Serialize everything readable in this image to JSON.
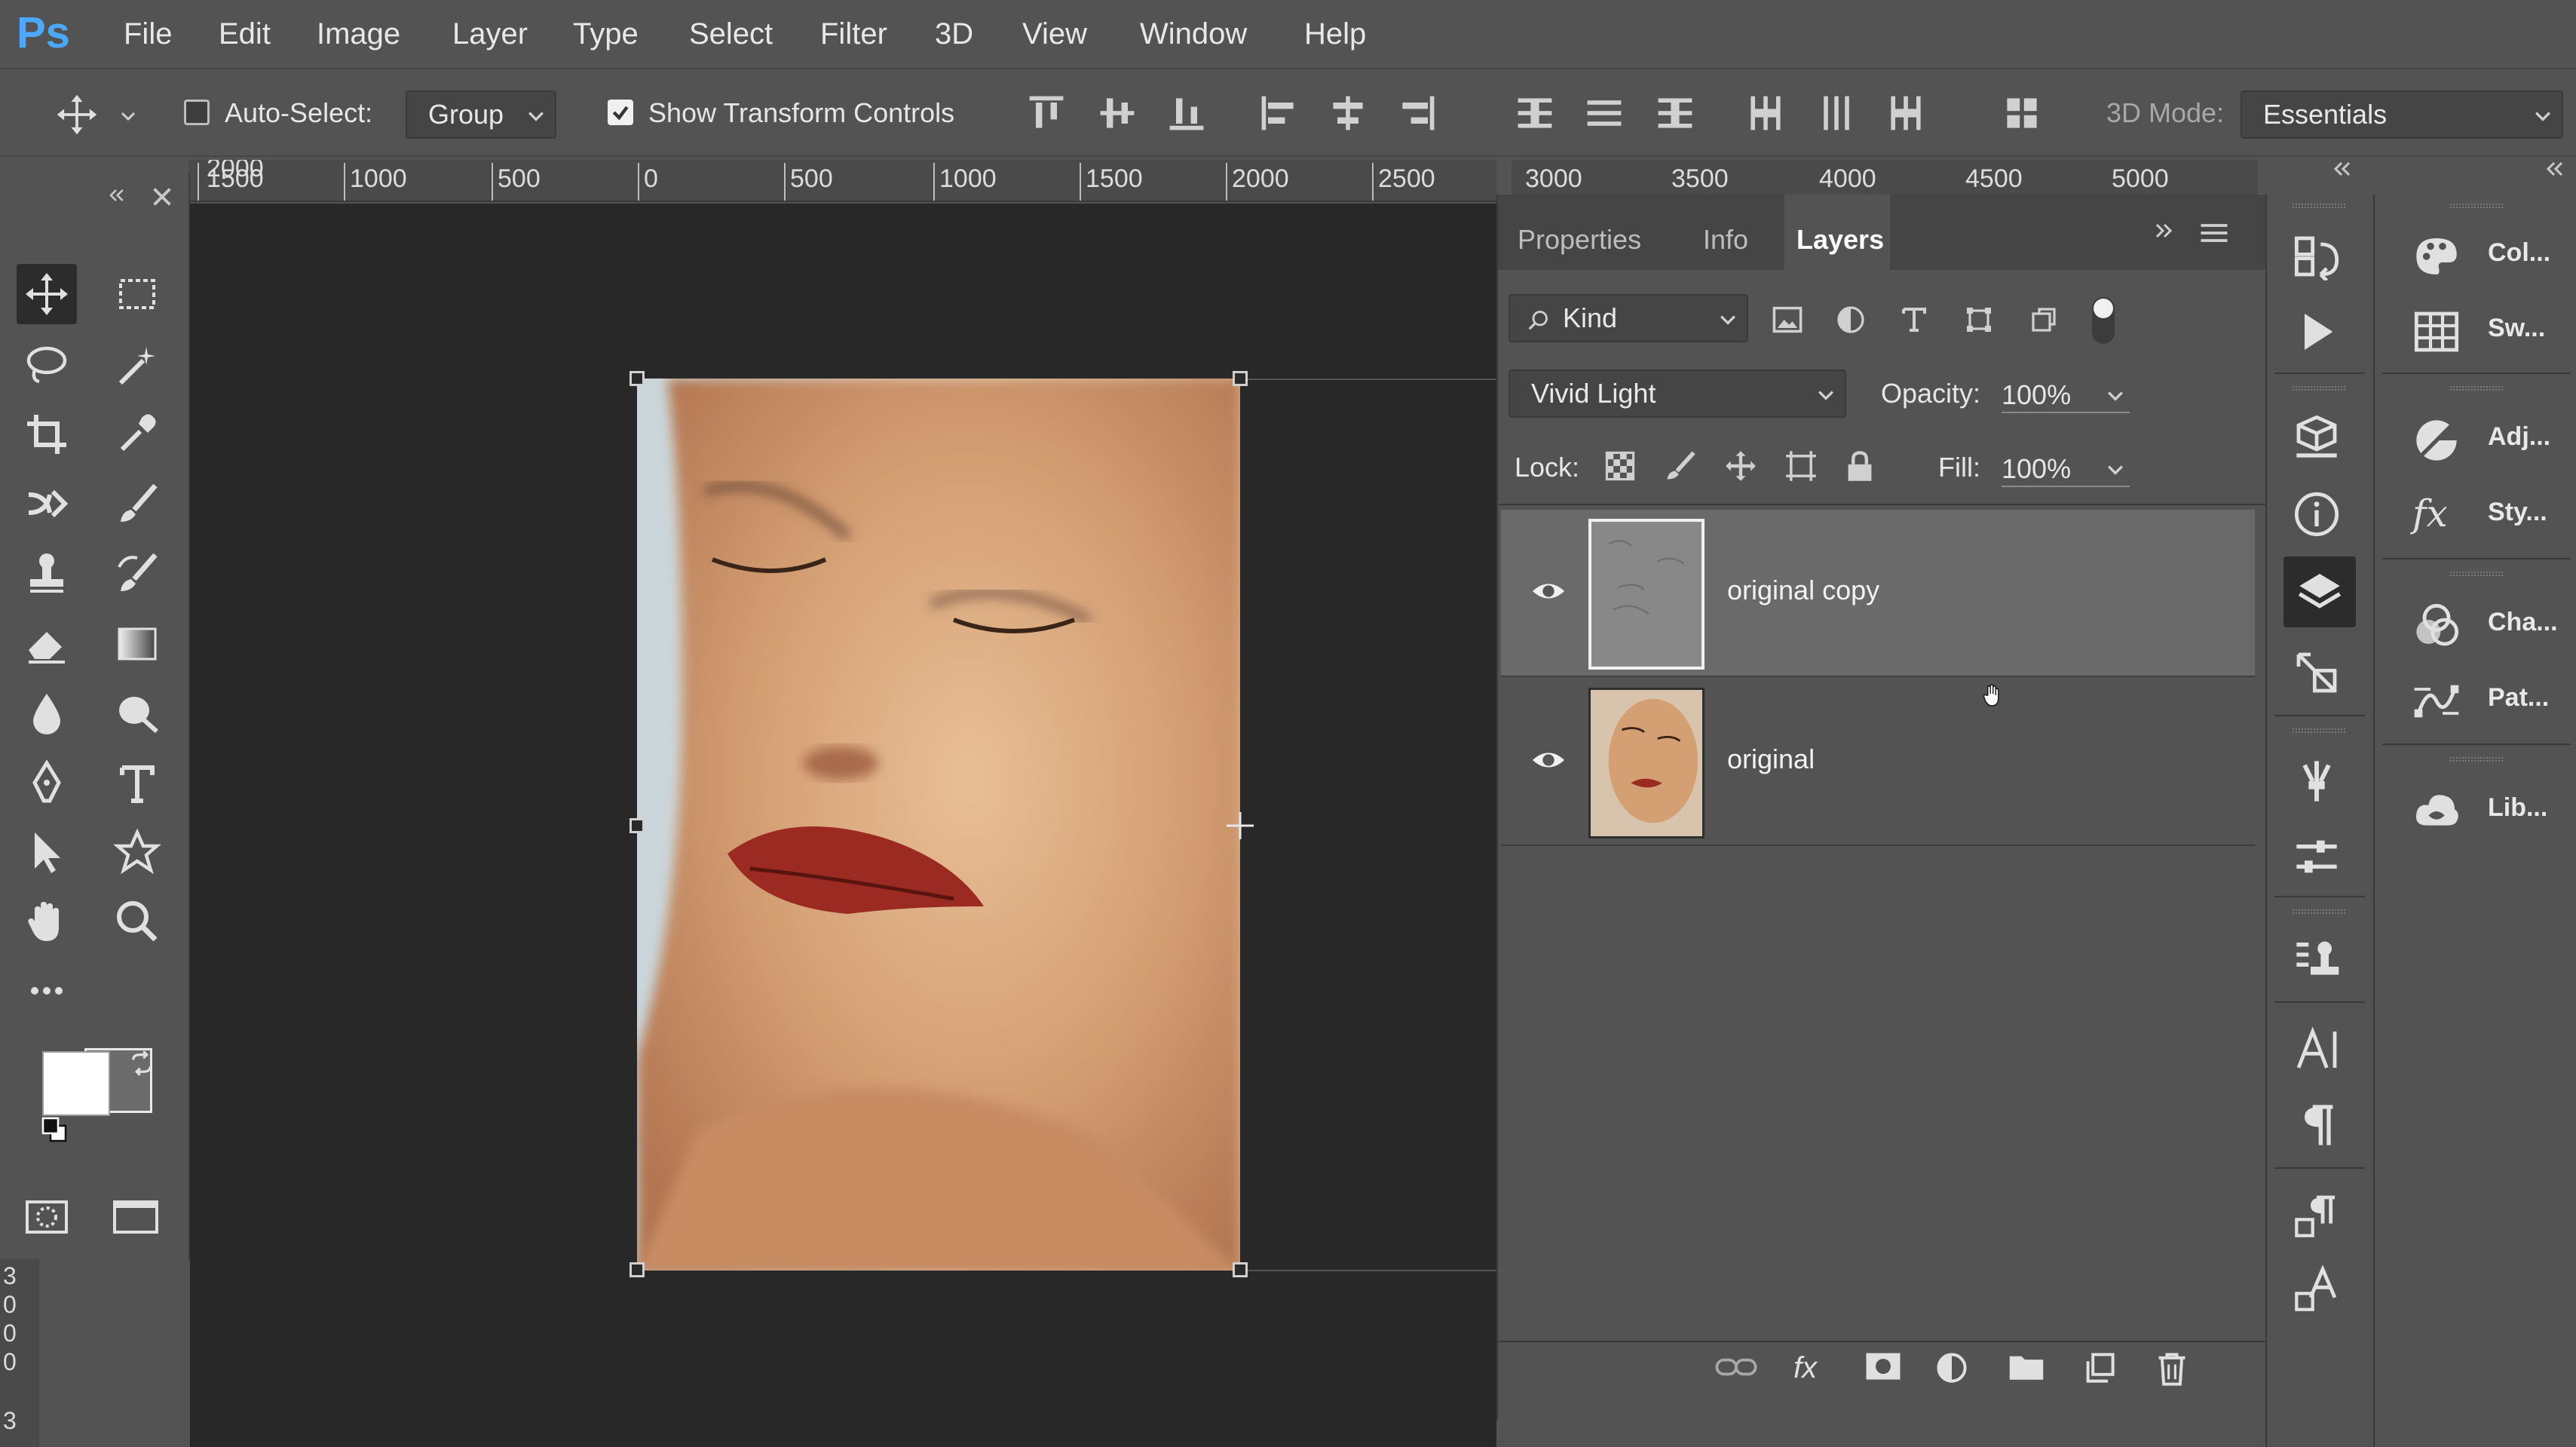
{
  "app": {
    "logo": "Ps"
  },
  "menu": [
    "File",
    "Edit",
    "Image",
    "Layer",
    "Type",
    "Select",
    "Filter",
    "3D",
    "View",
    "Window",
    "Help"
  ],
  "options": {
    "auto_select_label": "Auto-Select:",
    "auto_select_checked": false,
    "auto_select_mode": "Group",
    "show_transform_label": "Show Transform Controls",
    "show_transform_checked": true,
    "mode_3d_label": "3D Mode:",
    "workspace": "Essentials"
  },
  "ruler": {
    "top_labels": [
      "2000",
      "1500",
      "1000",
      "500",
      "0",
      "500",
      "1000",
      "1500",
      "2000",
      "2500"
    ],
    "top_labels_right": [
      "3000",
      "3500",
      "4000",
      "4500",
      "5000"
    ],
    "left_labels": [
      "3",
      "0",
      "0",
      "0",
      "3"
    ]
  },
  "layers_panel": {
    "tabs": [
      "Properties",
      "Info",
      "Layers"
    ],
    "active_tab": "Layers",
    "filter_kind": "Kind",
    "blend_mode": "Vivid Light",
    "opacity_label": "Opacity:",
    "opacity_value": "100%",
    "lock_label": "Lock:",
    "fill_label": "Fill:",
    "fill_value": "100%",
    "layers": [
      {
        "name": "original copy",
        "selected": true,
        "visible": true
      },
      {
        "name": "original",
        "selected": false,
        "visible": true
      }
    ]
  },
  "side_panels": [
    {
      "label": "Col...",
      "icon": "color-icon"
    },
    {
      "label": "Sw...",
      "icon": "swatches-icon"
    },
    {
      "label": "Adj...",
      "icon": "adjustments-icon"
    },
    {
      "label": "Sty...",
      "icon": "styles-icon"
    },
    {
      "label": "Cha...",
      "icon": "channels-icon"
    },
    {
      "label": "Pat...",
      "icon": "paths-icon"
    },
    {
      "label": "Lib...",
      "icon": "libraries-icon"
    }
  ],
  "colors": {
    "foreground": "#ffffff",
    "background": "#6b6b6b",
    "ui_bg": "#535353",
    "canvas_bg": "#282828",
    "selected_layer": "#6a6a6a",
    "logo": "#4aa8ff"
  }
}
